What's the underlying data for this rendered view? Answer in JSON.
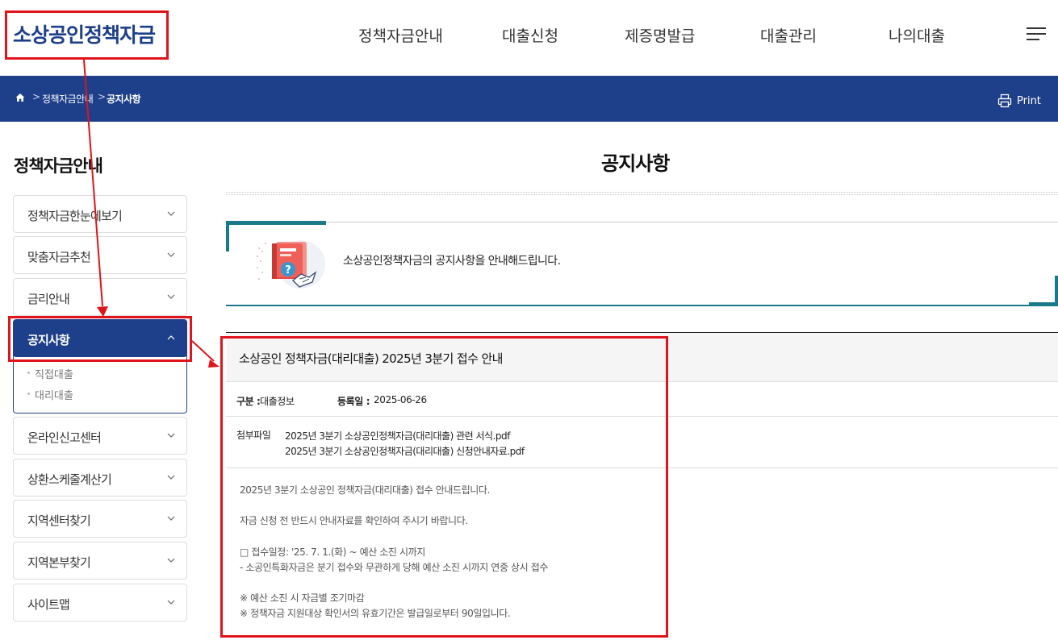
{
  "header": {
    "logo": "소상공인정책자금",
    "nav": [
      {
        "label": "정책자금안내"
      },
      {
        "label": "대출신청"
      },
      {
        "label": "제증명발급"
      },
      {
        "label": "대출관리"
      },
      {
        "label": "나의대출"
      }
    ],
    "menu_icon": "hamburger-menu-icon"
  },
  "breadcrumb": {
    "home_icon": "home-icon",
    "items": [
      "정책자금안내",
      "공지사항"
    ],
    "separator": ">",
    "print_label": "Print",
    "print_icon": "printer-icon"
  },
  "sidebar": {
    "title": "정책자금안내",
    "items": [
      {
        "label": "정책자금한눈에보기"
      },
      {
        "label": "맞춤자금추천"
      },
      {
        "label": "금리안내"
      },
      {
        "label": "공지사항",
        "active": true
      },
      {
        "label": "온라인신고센터"
      },
      {
        "label": "상환스케줄계산기"
      },
      {
        "label": "지역센터찾기"
      },
      {
        "label": "지역본부찾기"
      },
      {
        "label": "사이트맵"
      }
    ],
    "subitems": [
      "직접대출",
      "대리대출"
    ]
  },
  "content": {
    "page_title": "공지사항",
    "intro_text": "소상공인정책자금의 공지사항을 안내해드립니다.",
    "intro_icon": "notice-book-handshake-icon",
    "post": {
      "title": "소상공인 정책자금(대리대출) 2025년 3분기 접수 안내",
      "category_label": "구분 :",
      "category_value": "대출정보",
      "date_label": "등록일 :",
      "date_value": "2025-06-26",
      "attach_label": "첨부파일",
      "attachments": [
        "2025년 3분기 소상공인정책자금(대리대출) 관련 서식.pdf",
        "2025년 3분기 소상공인정책자금(대리대출) 신청안내자료.pdf"
      ],
      "body": [
        "2025년 3분기 소상공인 정책자금(대리대출) 접수 안내드립니다.",
        "자금 신청 전 반드시 안내자료를 확인하여 주시기 바랍니다.",
        "□ 접수일정: '25. 7. 1.(화) ~ 예산 소진 시까지",
        "- 소공인특화자금은 분기 접수와 무관하게 당해 예산 소진 시까지 연중 상시 접수",
        "※ 예산 소진 시 자금별 조기마감",
        "※ 정책자금 지원대상 확인서의 유효기간은 발급일로부터 90일입니다."
      ]
    }
  },
  "colors": {
    "primary_navy": "#1e3f89",
    "accent_teal": "#1a7a8a",
    "annotation_red": "#e0141a"
  }
}
